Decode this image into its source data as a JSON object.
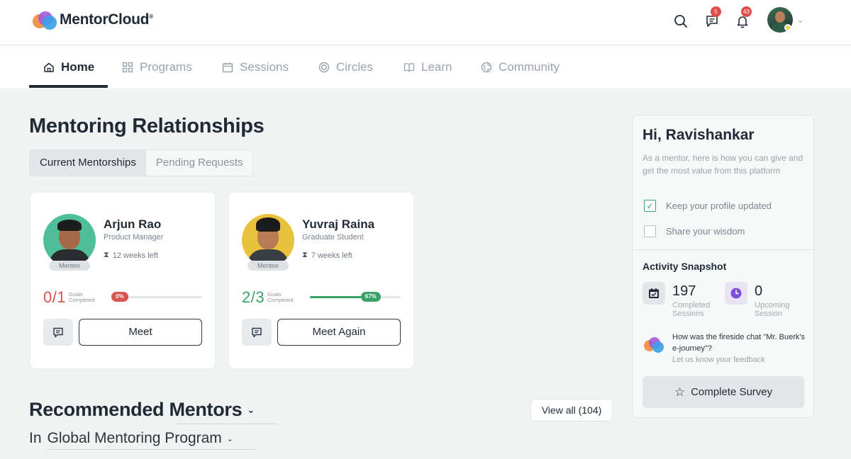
{
  "app": {
    "brand": "MentorCloud",
    "brand_mark": "®"
  },
  "header": {
    "messages_badge": "5",
    "notifications_badge": "43"
  },
  "nav": {
    "tabs": [
      {
        "label": "Home",
        "icon": "home-icon",
        "active": true
      },
      {
        "label": "Programs",
        "icon": "grid-icon"
      },
      {
        "label": "Sessions",
        "icon": "calendar-icon"
      },
      {
        "label": "Circles",
        "icon": "circles-icon"
      },
      {
        "label": "Learn",
        "icon": "book-icon"
      },
      {
        "label": "Community",
        "icon": "globe-icon"
      }
    ]
  },
  "relationships": {
    "title": "Mentoring Relationships",
    "tabs": [
      "Current Mentorships",
      "Pending Requests"
    ],
    "active_tab": "Current Mentorships",
    "cards": [
      {
        "name": "Arjun Rao",
        "role": "Product Manager",
        "weeks_left": "12 weeks left",
        "tag": "Mentee",
        "goals_done": "0",
        "goals_total": "/1",
        "goals_caption_1": "Goals",
        "goals_caption_2": "Completed",
        "progress_label": "0%",
        "progress": 0,
        "progress_color": "#d9534f",
        "meet_label": "Meet"
      },
      {
        "name": "Yuvraj Raina",
        "role": "Graduate Student",
        "weeks_left": "7 weeks left",
        "tag": "Mentee",
        "goals_done": "2",
        "goals_total": "/3",
        "goals_caption_1": "Goals",
        "goals_caption_2": "Completed",
        "progress_label": "67%",
        "progress": 67,
        "progress_color": "#3aa267",
        "meet_label": "Meet Again"
      }
    ]
  },
  "recommended": {
    "title": "Recommended Mentors",
    "prefix": "In",
    "program": "Global Mentoring Program",
    "view_all": "View all (104)"
  },
  "panel": {
    "greeting": "Hi, Ravishankar",
    "intro": "As a mentor, here is how you can give and get the most value from this platform",
    "checklist": [
      {
        "label": "Keep your profile updated",
        "checked": true
      },
      {
        "label": "Share your wisdom",
        "checked": false
      }
    ],
    "snapshot_title": "Activity Snapshot",
    "stats": [
      {
        "value": "197",
        "label_1": "Completed",
        "label_2": "Sessions",
        "icon": "calendar-check-icon"
      },
      {
        "value": "0",
        "label_1": "Upcoming",
        "label_2": "Session",
        "icon": "clock-icon"
      }
    ],
    "feedback_question": "How was the fireside chat \"Mr. Buerk's e-journey\"?",
    "feedback_sub": "Let us know your feedback",
    "survey_button": "Complete Survey"
  },
  "colors": {
    "accent_green": "#3aa267",
    "accent_red": "#d9534f",
    "clock_purple": "#7b4fd6",
    "text_dark": "#1f2a36"
  }
}
